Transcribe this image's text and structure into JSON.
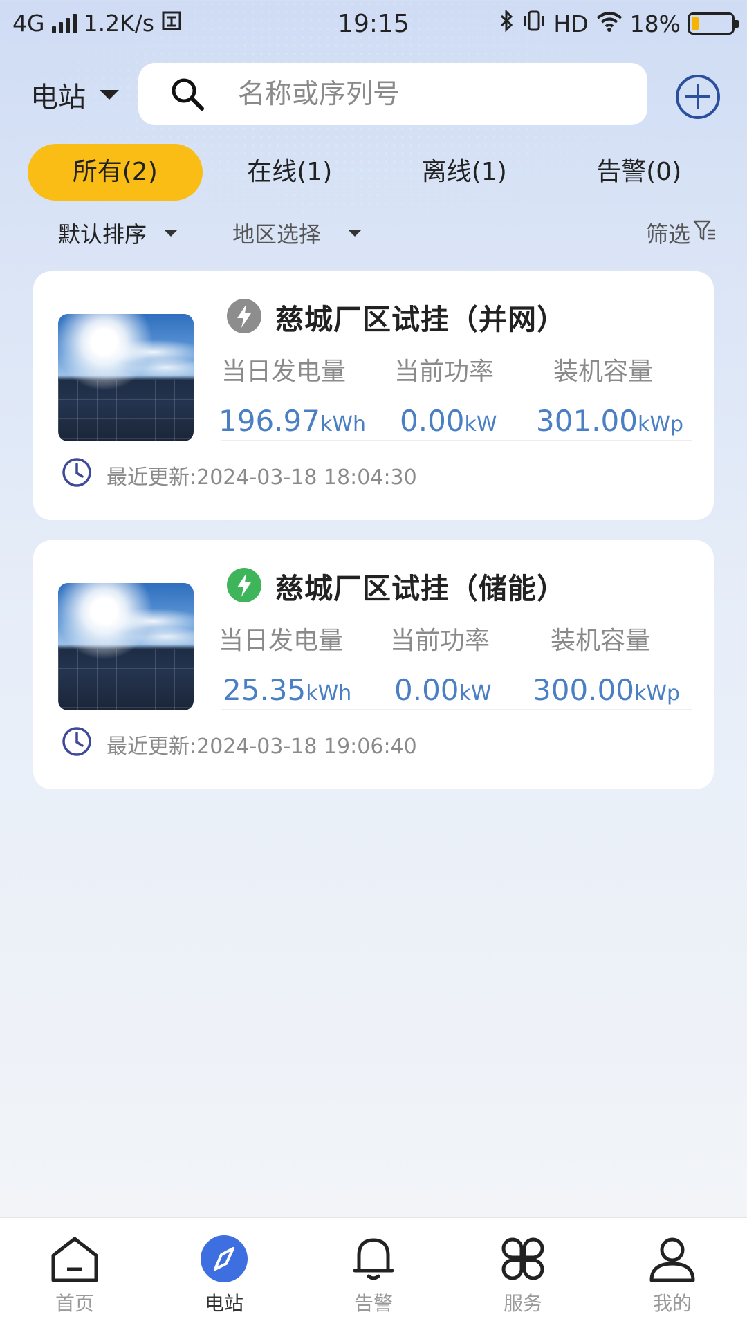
{
  "status_bar": {
    "network": "4G",
    "speed": "1.2K/s",
    "time": "19:15",
    "hd": "HD",
    "battery": "18%",
    "battery_level": 0.18
  },
  "header": {
    "station_select_label": "电站",
    "search_placeholder": "名称或序列号"
  },
  "tabs": [
    {
      "label": "所有(2)",
      "active": true
    },
    {
      "label": "在线(1)",
      "active": false
    },
    {
      "label": "离线(1)",
      "active": false
    },
    {
      "label": "告警(0)",
      "active": false
    }
  ],
  "sort_row": {
    "sort_label": "默认排序",
    "region_label": "地区选择",
    "filter_label": "筛选"
  },
  "stations": [
    {
      "name": "慈城厂区试挂（并网）",
      "status_color": "#8d8d8d",
      "stat_labels": [
        "当日发电量",
        "当前功率",
        "装机容量"
      ],
      "daily_energy": "196.97",
      "daily_energy_unit": "kWh",
      "current_power": "0.00",
      "current_power_unit": "kW",
      "capacity": "301.00",
      "capacity_unit": "kWp",
      "updated": "最近更新:2024-03-18 18:04:30"
    },
    {
      "name": "慈城厂区试挂（储能）",
      "status_color": "#3eb55a",
      "stat_labels": [
        "当日发电量",
        "当前功率",
        "装机容量"
      ],
      "daily_energy": "25.35",
      "daily_energy_unit": "kWh",
      "current_power": "0.00",
      "current_power_unit": "kW",
      "capacity": "300.00",
      "capacity_unit": "kWp",
      "updated": "最近更新:2024-03-18 19:06:40"
    }
  ],
  "bottom_nav": [
    {
      "label": "首页",
      "icon": "home-icon",
      "active": false
    },
    {
      "label": "电站",
      "icon": "compass-icon",
      "active": true
    },
    {
      "label": "告警",
      "icon": "bell-icon",
      "active": false
    },
    {
      "label": "服务",
      "icon": "service-grid-icon",
      "active": false
    },
    {
      "label": "我的",
      "icon": "user-icon",
      "active": false
    }
  ],
  "colors": {
    "accent_tab": "#f9bd15",
    "value_blue": "#4a7fc4",
    "nav_active": "#3e6fe0",
    "add_button": "#2a4f9c"
  }
}
